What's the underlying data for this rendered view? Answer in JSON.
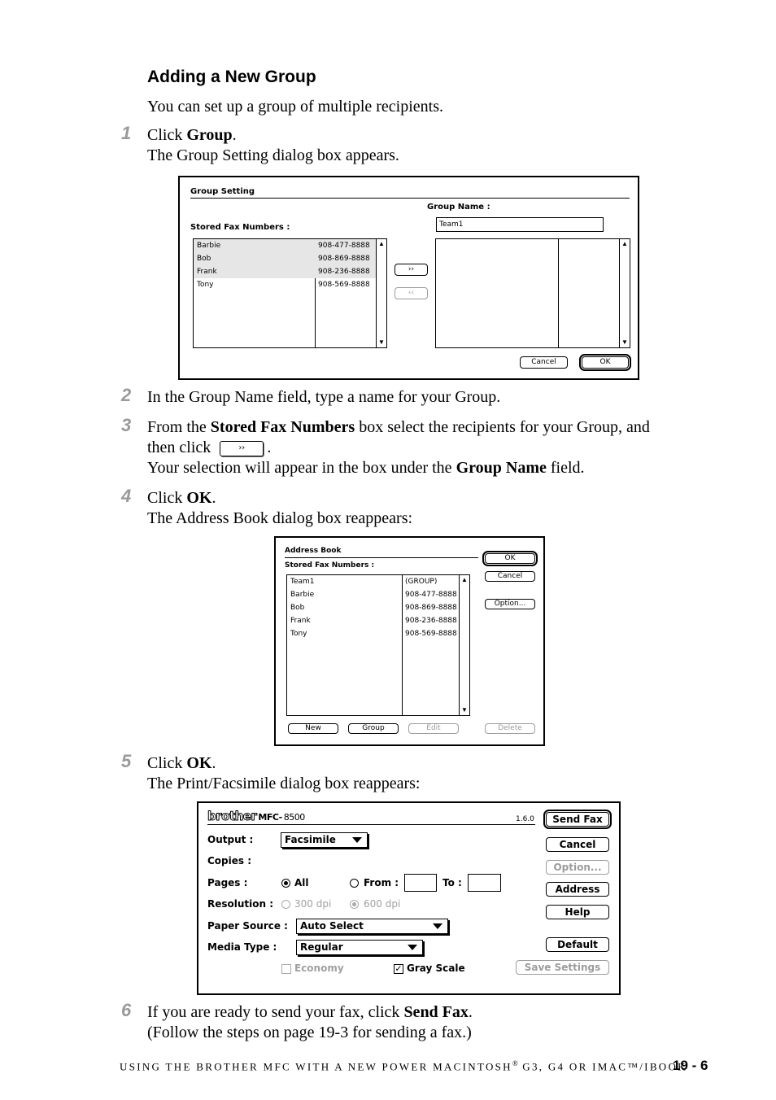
{
  "section_title": "Adding a New Group",
  "intro": "You can set up a group of multiple recipients.",
  "steps": [
    {
      "num": "1",
      "pre": "Click ",
      "bold": "Group",
      "post": ".",
      "line2": "The Group Setting dialog box appears."
    },
    {
      "num": "2",
      "text": "In the Group Name field, type a name for your Group."
    },
    {
      "num": "3",
      "pre": "From the ",
      "bold": "Stored Fax Numbers",
      "post": " box select the recipients for your Group, and",
      "line2_pre": "then click ",
      "line2_post": ".",
      "line3_pre": "Your selection will appear in the box under the ",
      "line3_bold": "Group Name",
      "line3_post": " field."
    },
    {
      "num": "4",
      "pre": "Click ",
      "bold": "OK",
      "post": ".",
      "line2": "The Address Book dialog box reappears:"
    },
    {
      "num": "5",
      "pre": "Click ",
      "bold": "OK",
      "post": ".",
      "line2": "The Print/Facsimile dialog box reappears:"
    },
    {
      "num": "6",
      "pre": "If you are ready to send your fax, click ",
      "bold": "Send Fax",
      "post": ".",
      "line2": "(Follow the steps on page 19-3 for sending a fax.)"
    }
  ],
  "group_dialog": {
    "title": "Group Setting",
    "group_name_label": "Group Name :",
    "group_name_value": "Team1",
    "stored_label": "Stored Fax Numbers :",
    "entries": [
      {
        "name": "Barbie",
        "number": "908-477-8888"
      },
      {
        "name": "Bob",
        "number": "908-869-8888"
      },
      {
        "name": "Frank",
        "number": "908-236-8888"
      },
      {
        "name": "Tony",
        "number": "908-569-8888"
      }
    ],
    "add_button": "››",
    "remove_button": "‹‹",
    "cancel": "Cancel",
    "ok": "OK"
  },
  "inline_button": "››",
  "address_dialog": {
    "title": "Address Book",
    "stored_label": "Stored Fax Numbers :",
    "entries": [
      {
        "name": "Team1",
        "number": "(GROUP)"
      },
      {
        "name": "Barbie",
        "number": "908-477-8888"
      },
      {
        "name": "Bob",
        "number": "908-869-8888"
      },
      {
        "name": "Frank",
        "number": "908-236-8888"
      },
      {
        "name": "Tony",
        "number": "908-569-8888"
      }
    ],
    "ok": "OK",
    "cancel": "Cancel",
    "option": "Option...",
    "new": "New",
    "group": "Group",
    "edit": "Edit",
    "delete": "Delete"
  },
  "fax_dialog": {
    "brand": "brother",
    "model_prefix": "MFC-",
    "model_number": "8500",
    "version": "1.6.0",
    "output_label": "Output :",
    "output_value": "Facsimile",
    "copies_label": "Copies :",
    "pages_label": "Pages :",
    "pages_all": "All",
    "pages_from": "From :",
    "pages_to": "To :",
    "resolution_label": "Resolution :",
    "res_300": "300 dpi",
    "res_600": "600 dpi",
    "paper_source_label": "Paper Source :",
    "paper_source_value": "Auto Select",
    "media_type_label": "Media Type :",
    "media_type_value": "Regular",
    "economy": "Economy",
    "gray_scale": "Gray Scale",
    "send_fax": "Send Fax",
    "cancel": "Cancel",
    "option": "Option...",
    "address": "Address",
    "help": "Help",
    "default": "Default",
    "save_settings": "Save Settings"
  },
  "footer": {
    "running_text": "USING THE BROTHER MFC WITH A NEW POWER MACINTOSH",
    "reg": "®",
    "running_text2": " G3, G4 OR IMAC™/IBOOK",
    "page": "19 - 6"
  }
}
